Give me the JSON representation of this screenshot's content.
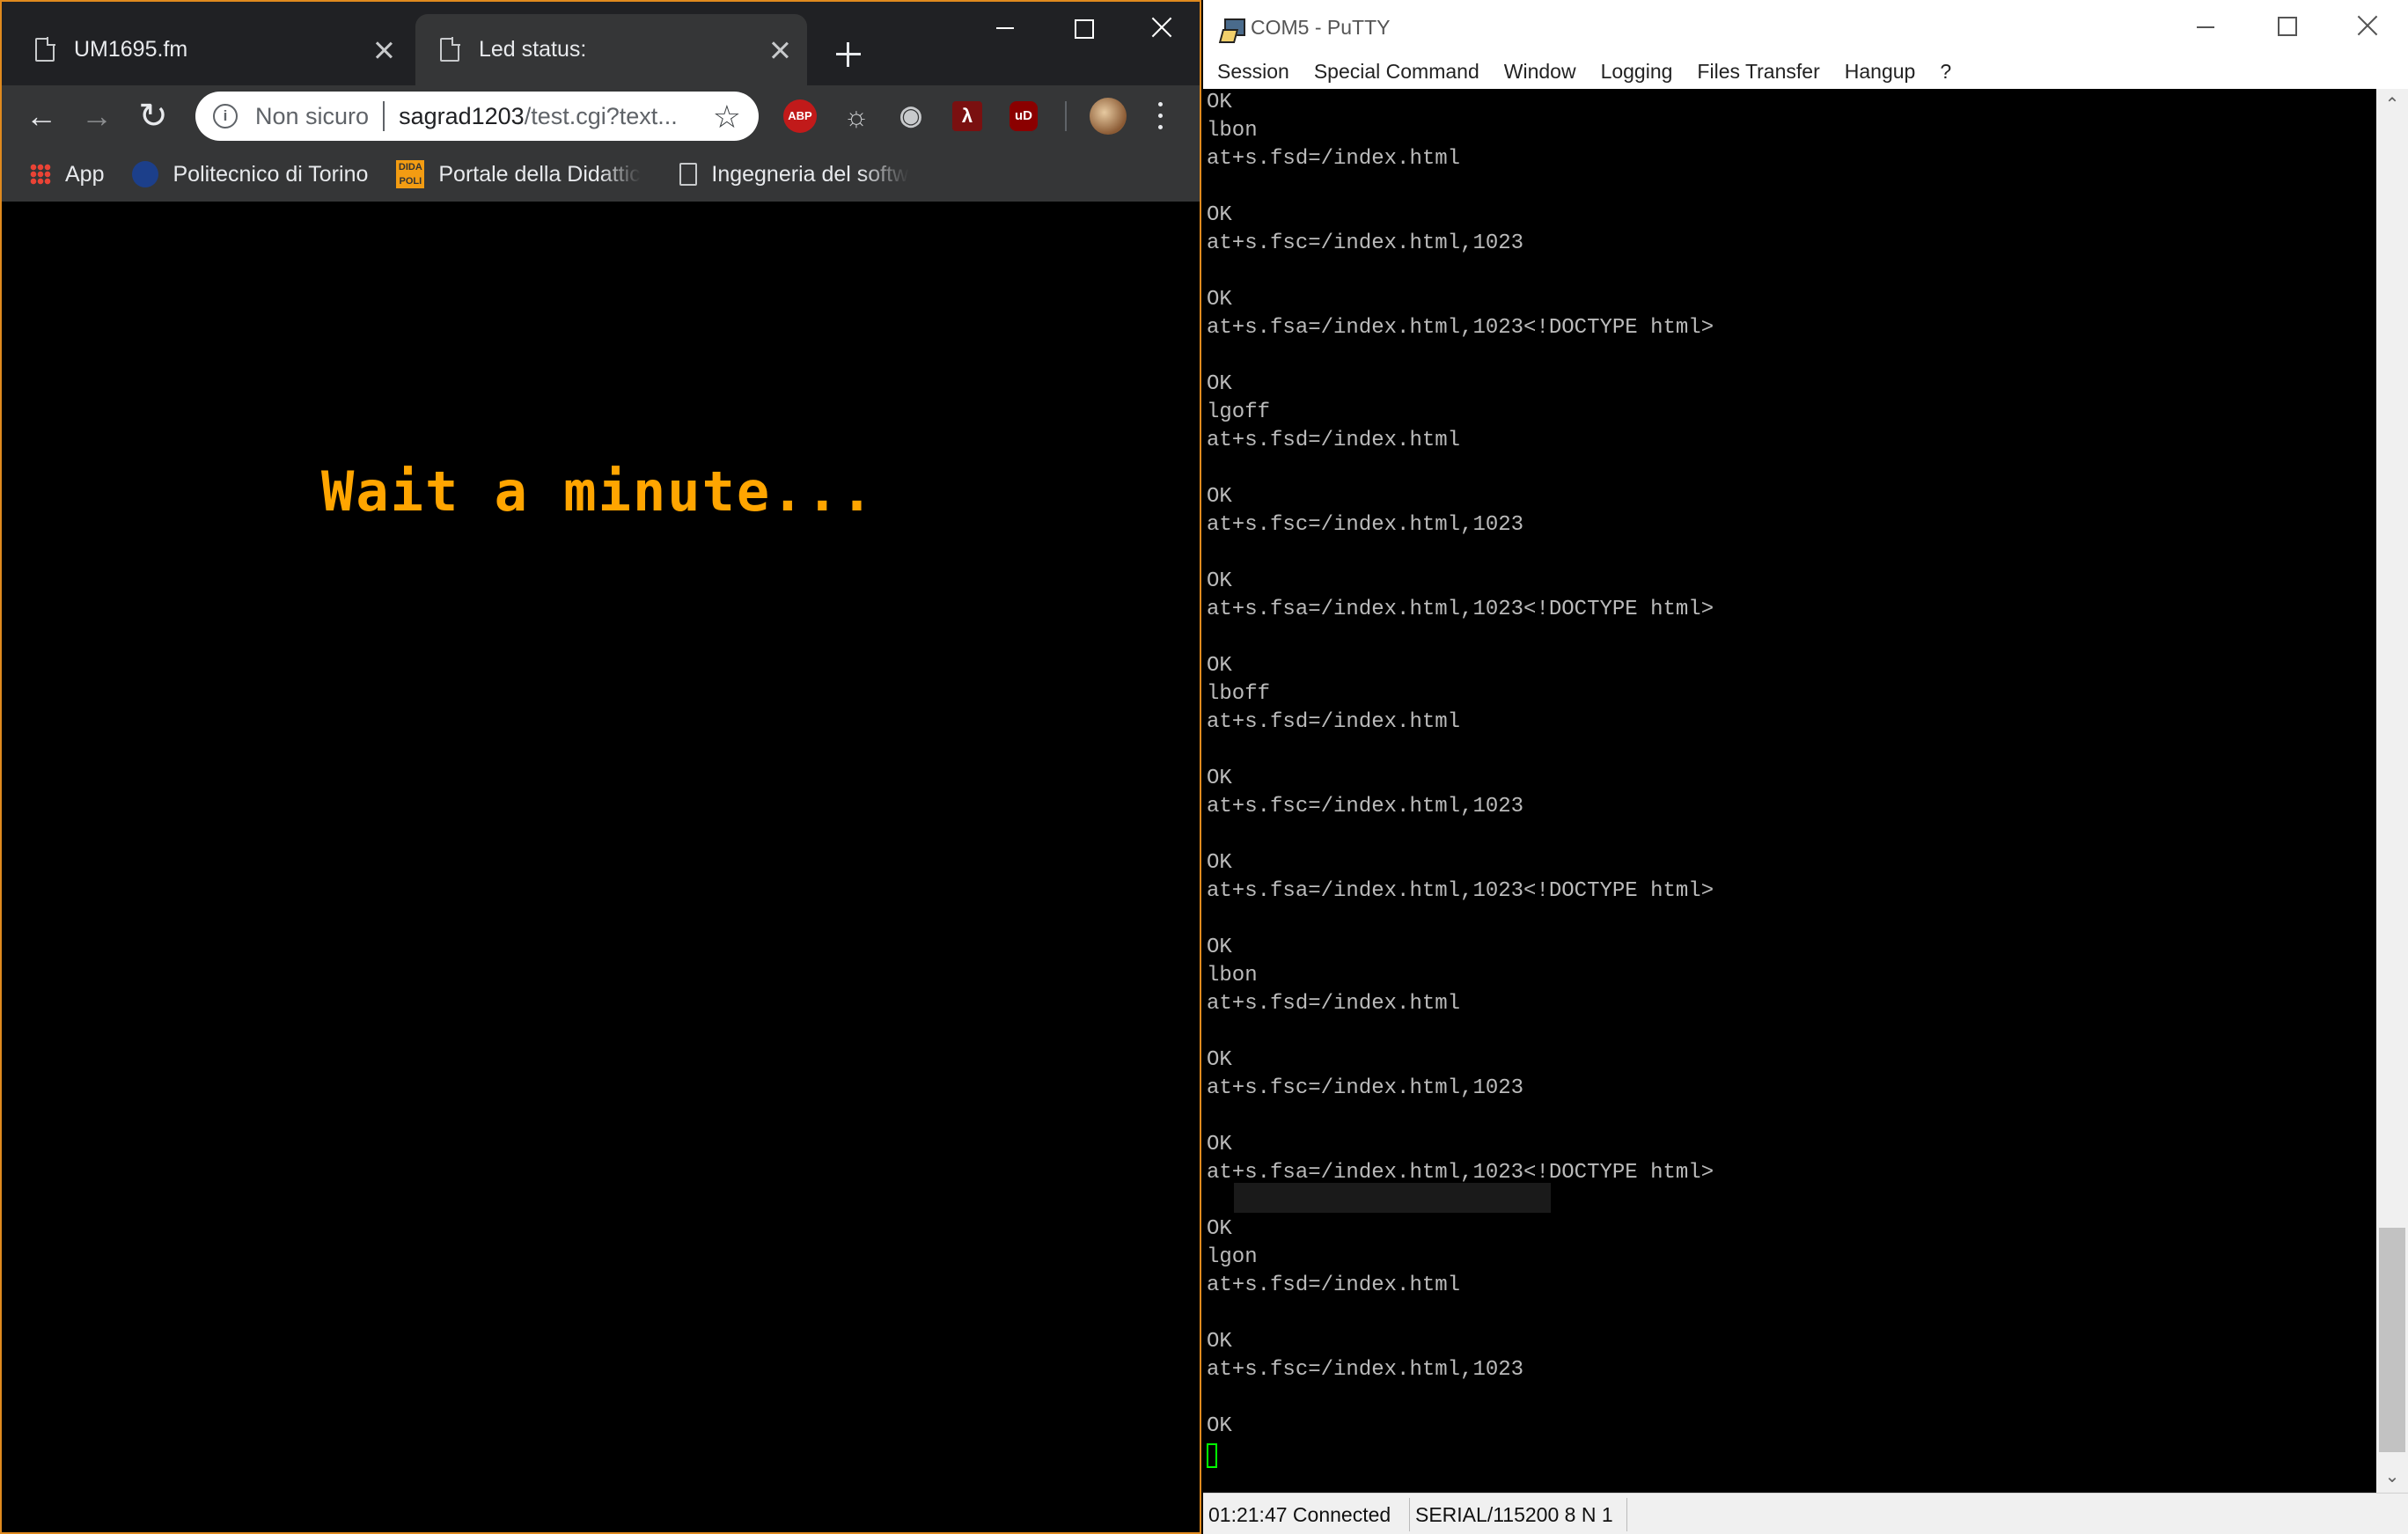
{
  "chrome": {
    "tabs": [
      {
        "title": "UM1695.fm"
      },
      {
        "title": "Led status:"
      }
    ],
    "omnibox": {
      "security": "Non sicuro",
      "host": "sagrad1203",
      "path": "/test.cgi?text..."
    },
    "extensions": {
      "abp": "ABP",
      "ublock": "uD"
    },
    "bookmarks": [
      {
        "label": "App"
      },
      {
        "label": "Politecnico di Torino"
      },
      {
        "label": "Portale della Didattica"
      },
      {
        "label": "Ingegneria del software"
      }
    ],
    "page": {
      "message": "Wait a minute..."
    }
  },
  "putty": {
    "title": "COM5 - PuTTY",
    "menu": [
      "Session",
      "Special Command",
      "Window",
      "Logging",
      "Files Transfer",
      "Hangup",
      "?"
    ],
    "terminal_lines": [
      "OK",
      "lbon",
      "at+s.fsd=/index.html",
      "",
      "OK",
      "at+s.fsc=/index.html,1023",
      "",
      "OK",
      "at+s.fsa=/index.html,1023<!DOCTYPE html>",
      "",
      "OK",
      "lgoff",
      "at+s.fsd=/index.html",
      "",
      "OK",
      "at+s.fsc=/index.html,1023",
      "",
      "OK",
      "at+s.fsa=/index.html,1023<!DOCTYPE html>",
      "",
      "OK",
      "lboff",
      "at+s.fsd=/index.html",
      "",
      "OK",
      "at+s.fsc=/index.html,1023",
      "",
      "OK",
      "at+s.fsa=/index.html,1023<!DOCTYPE html>",
      "",
      "OK",
      "lbon",
      "at+s.fsd=/index.html",
      "",
      "OK",
      "at+s.fsc=/index.html,1023",
      "",
      "OK",
      "at+s.fsa=/index.html,1023<!DOCTYPE html>",
      "",
      "OK",
      "lgon",
      "at+s.fsd=/index.html",
      "",
      "OK",
      "at+s.fsc=/index.html,1023",
      "",
      "OK"
    ],
    "status": {
      "connection": "01:21:47 Connected",
      "serial": "SERIAL/115200 8 N 1"
    },
    "colors": {
      "terminal_bg": "#000000",
      "terminal_fg": "#bbbbbb",
      "cursor": "#00ff00"
    }
  }
}
